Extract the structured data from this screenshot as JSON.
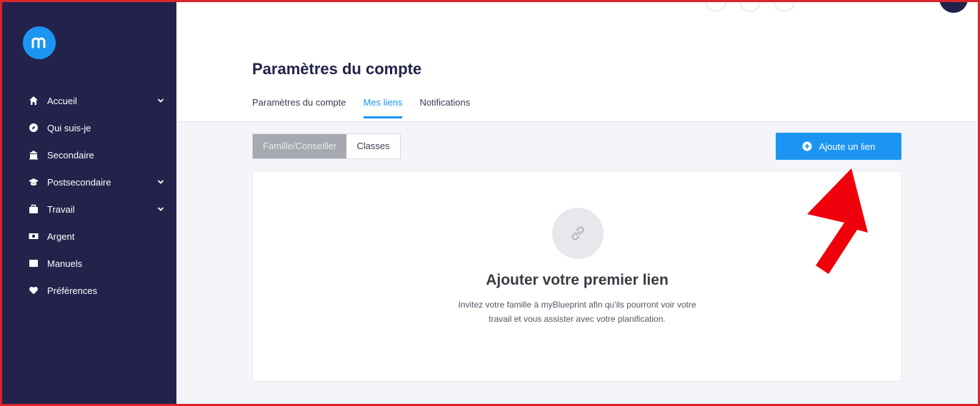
{
  "sidebar": {
    "logo_letter": "m",
    "items": [
      {
        "label": "Accueil",
        "icon": "home-icon",
        "has_chevron": true
      },
      {
        "label": "Qui suis-je",
        "icon": "compass-icon",
        "has_chevron": false
      },
      {
        "label": "Secondaire",
        "icon": "school-icon",
        "has_chevron": false
      },
      {
        "label": "Postsecondaire",
        "icon": "graduation-cap-icon",
        "has_chevron": true
      },
      {
        "label": "Travail",
        "icon": "briefcase-icon",
        "has_chevron": true
      },
      {
        "label": "Argent",
        "icon": "money-icon",
        "has_chevron": false
      },
      {
        "label": "Manuels",
        "icon": "book-icon",
        "has_chevron": false
      },
      {
        "label": "Préférences",
        "icon": "heart-icon",
        "has_chevron": false
      }
    ]
  },
  "header": {
    "title": "Paramètres du compte",
    "tabs": [
      {
        "label": "Paramètres du compte",
        "active": false
      },
      {
        "label": "Mes liens",
        "active": true
      },
      {
        "label": "Notifications",
        "active": false
      }
    ]
  },
  "filters": {
    "segments": [
      {
        "label": "Famille/Conseiller",
        "active": true
      },
      {
        "label": "Classes",
        "active": false
      }
    ]
  },
  "actions": {
    "add_link_label": "Ajoute un lien"
  },
  "empty_state": {
    "icon": "link-icon",
    "title": "Ajouter votre premier lien",
    "description": "Invitez votre famille à myBlueprint afin qu'ils pourront voir votre travail et vous assister avec votre planification."
  },
  "colors": {
    "sidebar_bg": "#22224a",
    "accent": "#1c95f2",
    "annotation": "#f0000a"
  }
}
